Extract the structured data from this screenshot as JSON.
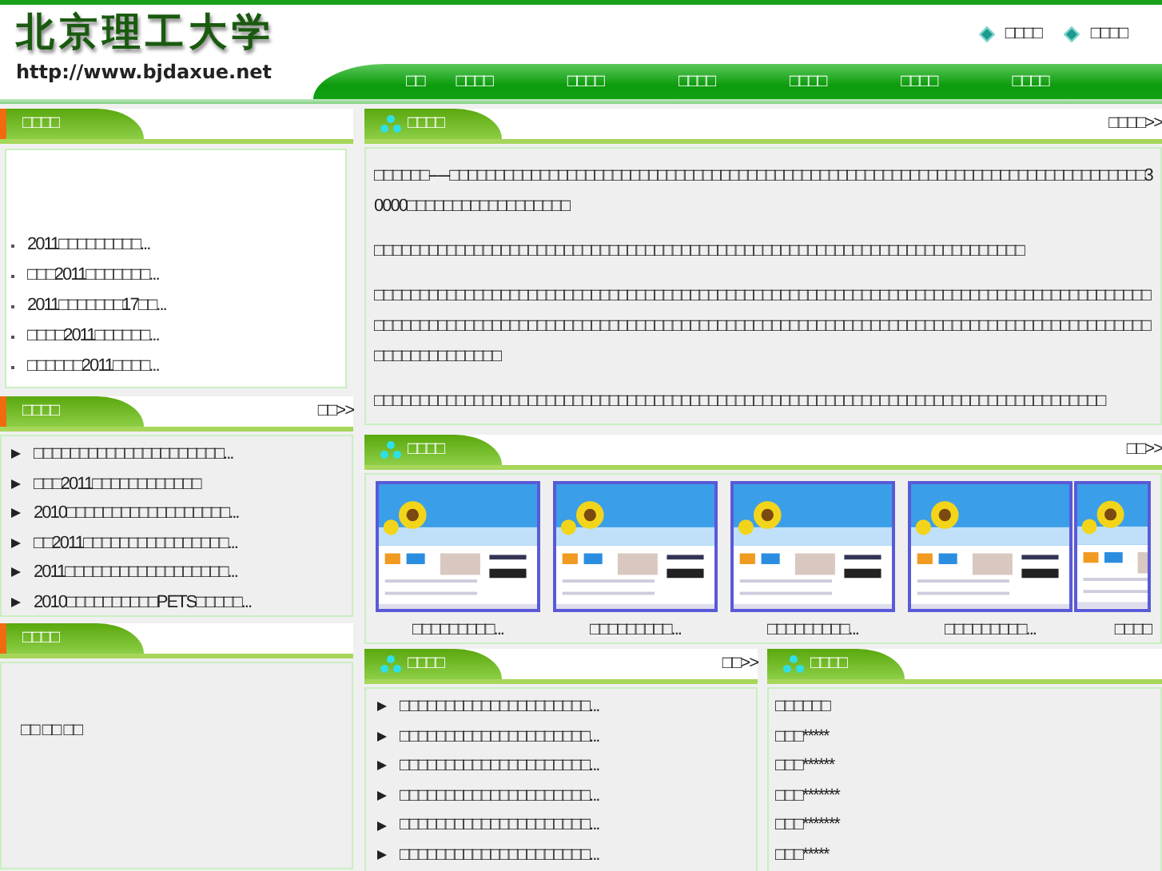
{
  "header": {
    "logo_title": "北京理工大学",
    "logo_url": "http://www.bjdaxue.net",
    "top_links": [
      "□□□□",
      "□□□□"
    ],
    "nav": [
      "□□",
      "□□□□",
      "□□□□",
      "□□□□",
      "□□□□",
      "□□□□",
      "□□□□"
    ]
  },
  "news_panel": {
    "title": "□□□□",
    "items": [
      "2011□□□□□□□□□...",
      "□□□2011□□□□□□□...",
      "2011□□□□□□□17□□...",
      "□□□□2011□□□□□□...",
      "□□□□□□2011□□□□..."
    ]
  },
  "notices_panel": {
    "title": "□□□□",
    "more": "□□>>",
    "items": [
      "□□□□□□□□□□□□□□□□□□□□□...",
      "□□□2011□□□□□□□□□□□□",
      "2010□□□□□□□□□□□□□□□□□□...",
      "□□2011□□□□□□□□□□□□□□□□...",
      "2011□□□□□□□□□□□□□□□□□□...",
      "2010□□□□□□□□□□PETS□□□□□..."
    ]
  },
  "contact_panel": {
    "title": "□□□□",
    "text": "□□ □□ □□"
  },
  "intro_panel": {
    "title": "□□□□",
    "more": "□□□□>>",
    "paragraphs": [
      "□□□□□□-----□□□□□□□□□□□□□□□□□□□□□□□□□□□□□□□□□□□□□□□□□□□□□□□□□□□□□□□□□□□□□□□□□□□□□□□□□□□□□30000□□□□□□□□□□□□□□□□□□",
      "□□□□□□□□□□□□□□□□□□□□□□□□□□□□□□□□□□□□□□□□□□□□□□□□□□□□□□□□□□□□□□□□□□□□□□□□",
      "□□□□□□□□□□□□□□□□□□□□□□□□□□□□□□□□□□□□□□□□□□□□□□□□□□□□□□□□□□□□□□□□□□□□□□□□□□□□□□□□□□□□□□□□□□□□□□□□□□□□□□□□□□□□□□□□□□□□□□□□□□□□□□□□□□□□□□□□□□□□□□□□□□□□□□□□□□□□□□□□□□□□□□□□□□□□□□□□□□□□□□□□□□",
      "□□□□□□□□□□□□□□□□□□□□□□□□□□□□□□□□□□□□□□□□□□□□□□□□□□□□□□□□□□□□□□□□□□□□□□□□□□□□□□□□□"
    ]
  },
  "gallery_panel": {
    "title": "□□□□",
    "more": "□□>>",
    "items": [
      {
        "caption": "□□□□□□□□□..."
      },
      {
        "caption": "□□□□□□□□□..."
      },
      {
        "caption": "□□□□□□□□□..."
      },
      {
        "caption": "□□□□□□□□□..."
      },
      {
        "caption": "□□□□"
      }
    ]
  },
  "articles_panel": {
    "title": "□□□□",
    "more": "□□>>",
    "items": [
      "□□□□□□□□□□□□□□□□□□□□□...",
      "□□□□□□□□□□□□□□□□□□□□□...",
      "□□□□□□□□□□□□□□□□□□□□□...",
      "□□□□□□□□□□□□□□□□□□□□□...",
      "□□□□□□□□□□□□□□□□□□□□□...",
      "□□□□□□□□□□□□□□□□□□□□□..."
    ]
  },
  "members_panel": {
    "title": "□□□□",
    "items": [
      "□□□□□□",
      "□□□*****",
      "□□□******",
      "□□□*******",
      "□□□*******",
      "□□□*****"
    ]
  }
}
